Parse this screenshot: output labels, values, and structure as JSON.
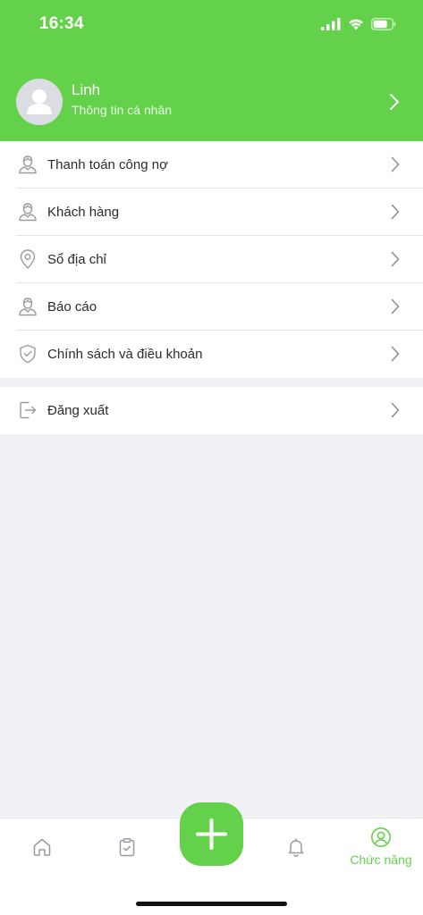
{
  "status_bar": {
    "time": "16:34"
  },
  "profile": {
    "name": "Linh",
    "subtitle": "Thông tin cá nhân"
  },
  "menu": [
    {
      "label": "Thanh toán công nợ",
      "icon": "person-icon"
    },
    {
      "label": "Khách hàng",
      "icon": "person-icon"
    },
    {
      "label": "Sổ địa chỉ",
      "icon": "location-pin-icon"
    },
    {
      "label": "Báo cáo",
      "icon": "person-icon"
    },
    {
      "label": "Chính sách và điều khoản",
      "icon": "shield-check-icon"
    }
  ],
  "logout": {
    "label": "Đăng xuất",
    "icon": "logout-icon"
  },
  "tabbar": {
    "items": [
      {
        "icon": "home-icon"
      },
      {
        "icon": "clipboard-icon"
      },
      {
        "icon": "plus-icon"
      },
      {
        "icon": "bell-icon"
      },
      {
        "icon": "user-circle-icon",
        "label": "Chức năng",
        "active": true
      }
    ]
  },
  "colors": {
    "accent": "#63d149",
    "background": "#f1f1f5",
    "text": "#2b2b2b",
    "icon_gray": "#9a9aa6"
  }
}
